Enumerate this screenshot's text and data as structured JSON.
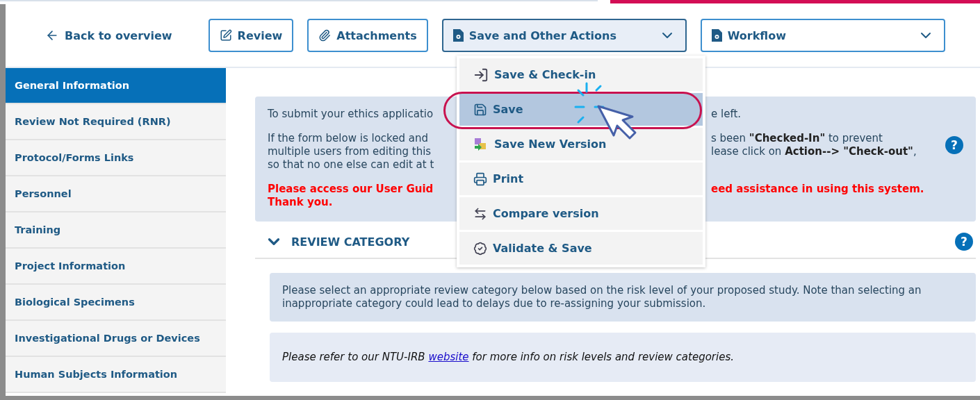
{
  "back_link": {
    "label": "Back to overview"
  },
  "toolbar": [
    {
      "kind": "button",
      "label": "Review"
    },
    {
      "kind": "button",
      "label": "Attachments"
    },
    {
      "kind": "dropdown",
      "label": "Save and Other Actions",
      "expanded": true
    },
    {
      "kind": "dropdown",
      "label": "Workflow",
      "expanded": false
    }
  ],
  "menu": [
    {
      "label": "Save & Check-in",
      "selected": false
    },
    {
      "label": "Save",
      "selected": true
    },
    {
      "label": "Save New Version",
      "selected": false
    },
    {
      "label": "Print",
      "selected": false
    },
    {
      "label": "Compare version",
      "selected": false
    },
    {
      "label": "Validate & Save",
      "selected": false
    }
  ],
  "sidebar": {
    "items": [
      {
        "label": "General Information",
        "selected": true
      },
      {
        "label": "Review Not Required (RNR)",
        "selected": false
      },
      {
        "label": "Protocol/Forms Links",
        "selected": false
      },
      {
        "label": "Personnel",
        "selected": false
      },
      {
        "label": "Training",
        "selected": false
      },
      {
        "label": "Project Information",
        "selected": false
      },
      {
        "label": "Biological Specimens",
        "selected": false
      },
      {
        "label": "Investigational Drugs or Devices",
        "selected": false
      },
      {
        "label": "Human Subjects Information",
        "selected": false
      }
    ]
  },
  "notice": [
    {
      "kind": "note",
      "left": [
        "To submit your ethics applicatio"
      ],
      "right": [
        "e left."
      ]
    },
    {
      "kind": "note",
      "help": "?",
      "left": [
        "If the form below is locked and",
        "multiple users from editing this",
        "so that no one else can edit at t"
      ],
      "right": [
        "s been **\"Checked-In\"** to prevent",
        "lease click on **Action--> \"Check-out\"**,"
      ]
    },
    {
      "kind": "alert",
      "left": [
        "Please access our User Guid",
        "Thank you."
      ],
      "right": [
        "eed assistance in using this system."
      ]
    }
  ],
  "section": {
    "title": "REVIEW CATEGORY",
    "help": "?",
    "expanded": true,
    "boxes": [
      {
        "kind": "text",
        "text": "Please select an appropriate review category below based on the risk level of your proposed study. Note than selecting an inappropriate category could lead to delays due to re-assigning your submission."
      },
      {
        "kind": "link",
        "before": "Please refer to our NTU-IRB",
        "link": "website",
        "after": "for more info on risk levels and review categories."
      }
    ]
  }
}
